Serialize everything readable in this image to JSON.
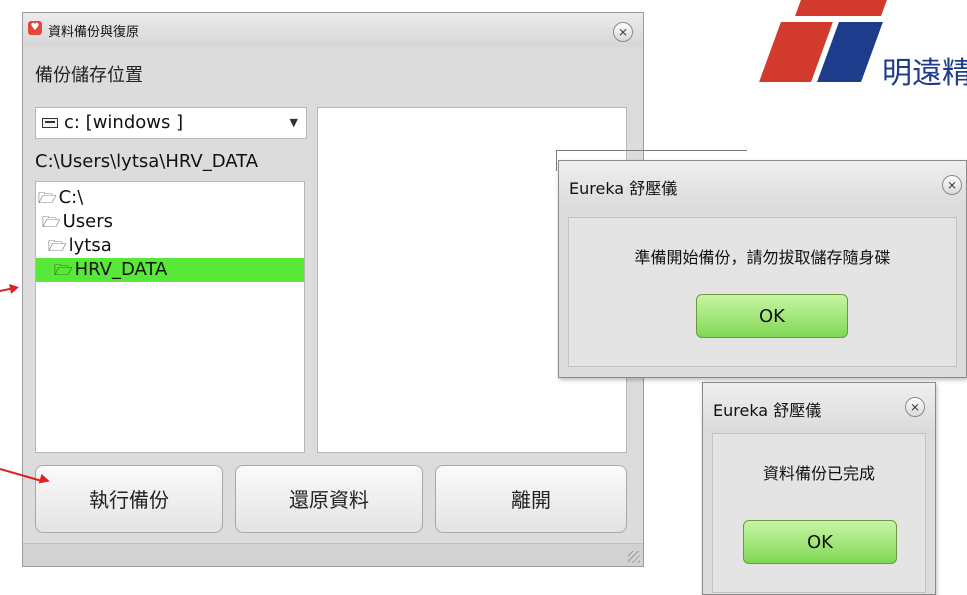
{
  "colors": {
    "logo_red": "#d23a2e",
    "logo_blue": "#1d3d8c",
    "selected_green": "#58e838",
    "ok_green": "#7fd854",
    "arrow_red": "#e02020"
  },
  "window": {
    "title": "資料備份與復原",
    "close_icon": "⨯",
    "section_label": "備份儲存位置",
    "drive": {
      "value": "c: [windows ]",
      "icon": "drive-icon"
    },
    "path": "C:\\Users\\lytsa\\HRV_DATA",
    "tree": [
      {
        "label": "C:\\",
        "icon": "folder-open-icon"
      },
      {
        "label": "Users",
        "icon": "folder-open-icon"
      },
      {
        "label": "lytsa",
        "icon": "folder-open-icon"
      },
      {
        "label": "HRV_DATA",
        "icon": "folder-open-icon",
        "selected": true
      }
    ],
    "buttons": {
      "backup": "執行備份",
      "restore": "還原資料",
      "exit": "離開"
    }
  },
  "logo": {
    "text": "明遠精"
  },
  "dialog1": {
    "title": "Eureka 舒壓儀",
    "message": "準備開始備份，請勿拔取儲存隨身碟",
    "ok": "OK"
  },
  "dialog2": {
    "title": "Eureka 舒壓儀",
    "message": "資料備份已完成",
    "ok": "OK"
  }
}
